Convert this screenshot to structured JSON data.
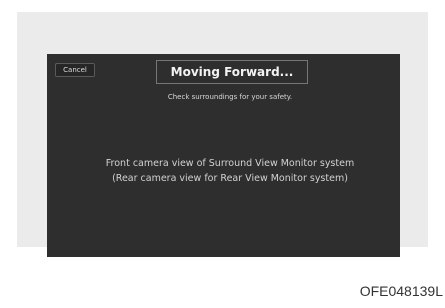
{
  "screen": {
    "cancel_label": "Cancel",
    "title": "Moving Forward...",
    "safety_message": "Check surroundings for your safety.",
    "camera_text_line1": "Front camera view of Surround View Monitor system",
    "camera_text_line2": "(Rear camera view for Rear View Monitor system)"
  },
  "caption": "OFE048139L",
  "colors": {
    "frame_background": "#ebebeb",
    "screen_background": "#2e2e2e",
    "text": "#d2d2d2"
  }
}
